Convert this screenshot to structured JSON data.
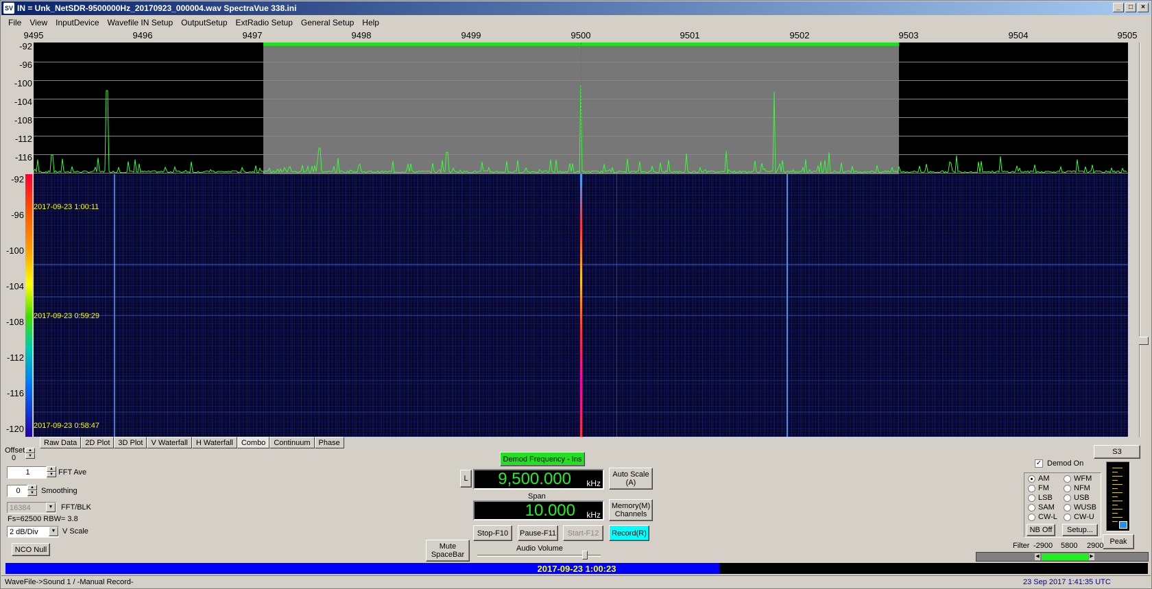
{
  "window": {
    "title": "IN = Unk_NetSDR-9500000Hz_20170923_000004.wav    SpectraVue 338.ini",
    "icon_text": "SV",
    "min_label": "_",
    "max_label": "□",
    "close_label": "×"
  },
  "menu": [
    "File",
    "View",
    "InputDevice",
    "Wavefile IN Setup",
    "OutputSetup",
    "ExtRadio Setup",
    "General Setup",
    "Help"
  ],
  "freq_axis": [
    "9495",
    "9496",
    "9497",
    "9498",
    "9499",
    "9500",
    "9501",
    "9502",
    "9503",
    "9504",
    "9505"
  ],
  "spectrum_y_labels": [
    "-92",
    "-96",
    "-100",
    "-104",
    "-108",
    "-112",
    "-116"
  ],
  "waterfall_y_labels": [
    "-92",
    "-96",
    "-100",
    "-104",
    "-108",
    "-112",
    "-116",
    "-120"
  ],
  "waterfall_times": [
    "2017-09-23 1:00:11",
    "2017-09-23 0:59:29",
    "2017-09-23 0:58:47"
  ],
  "tabs": [
    "Raw Data",
    "2D Plot",
    "3D Plot",
    "V Waterfall",
    "H Waterfall",
    "Combo",
    "Continuum",
    "Phase"
  ],
  "active_tab": "Combo",
  "left_panel": {
    "offset_label": "Offset",
    "offset_value": "0",
    "fft_ave_value": "1",
    "fft_ave_label": "FFT Ave",
    "smoothing_value": "0",
    "smoothing_label": "Smoothing",
    "fft_blk_value": "16384",
    "fft_blk_label": "FFT/BLK",
    "fs_text": "Fs=62500 RBW= 3.8",
    "vscale_value": "2 dB/Div",
    "vscale_label": "V Scale",
    "nco_null": "NCO Null"
  },
  "center_panel": {
    "demod_freq_button": "Demod Frequency - Ins",
    "l_button": "L",
    "freq_value": "9,500.000",
    "freq_unit": "kHz",
    "auto_scale": "Auto Scale (A)",
    "span_label": "Span",
    "span_value": "10.000",
    "span_unit": "kHz",
    "memory_channels": "Memory(M) Channels",
    "stop": "Stop-F10",
    "pause": "Pause-F11",
    "start": "Start-F12",
    "record": "Record(R)",
    "mute": "Mute SpaceBar",
    "audio_volume": "Audio Volume"
  },
  "audio_volume_level": 0.87,
  "right_panel": {
    "s_meter_label": "S3",
    "demod_on_label": "Demod On",
    "demod_on_checked": true,
    "modes": [
      "AM",
      "WFM",
      "FM",
      "NFM",
      "LSB",
      "USB",
      "SAM",
      "WUSB",
      "CW-L",
      "CW-U"
    ],
    "selected_mode": "AM",
    "nb_off": "NB Off",
    "setup": "Setup...",
    "peak": "Peak",
    "filter_label": "Filter",
    "filter_low": "-2900",
    "filter_width": "5800",
    "filter_high": "2900"
  },
  "playback": {
    "timestamp": "2017-09-23 1:00:23",
    "progress": 0.625
  },
  "status": {
    "left": "WaveFile->Sound 1  / -Manual Record-",
    "right": "23 Sep 2017   1:41:35 UTC"
  },
  "colors": {
    "spectrum_trace": "#33ff33",
    "passband": "#777777",
    "progress_fill": "#0000ff",
    "timestamp_text": "#ffff00"
  }
}
